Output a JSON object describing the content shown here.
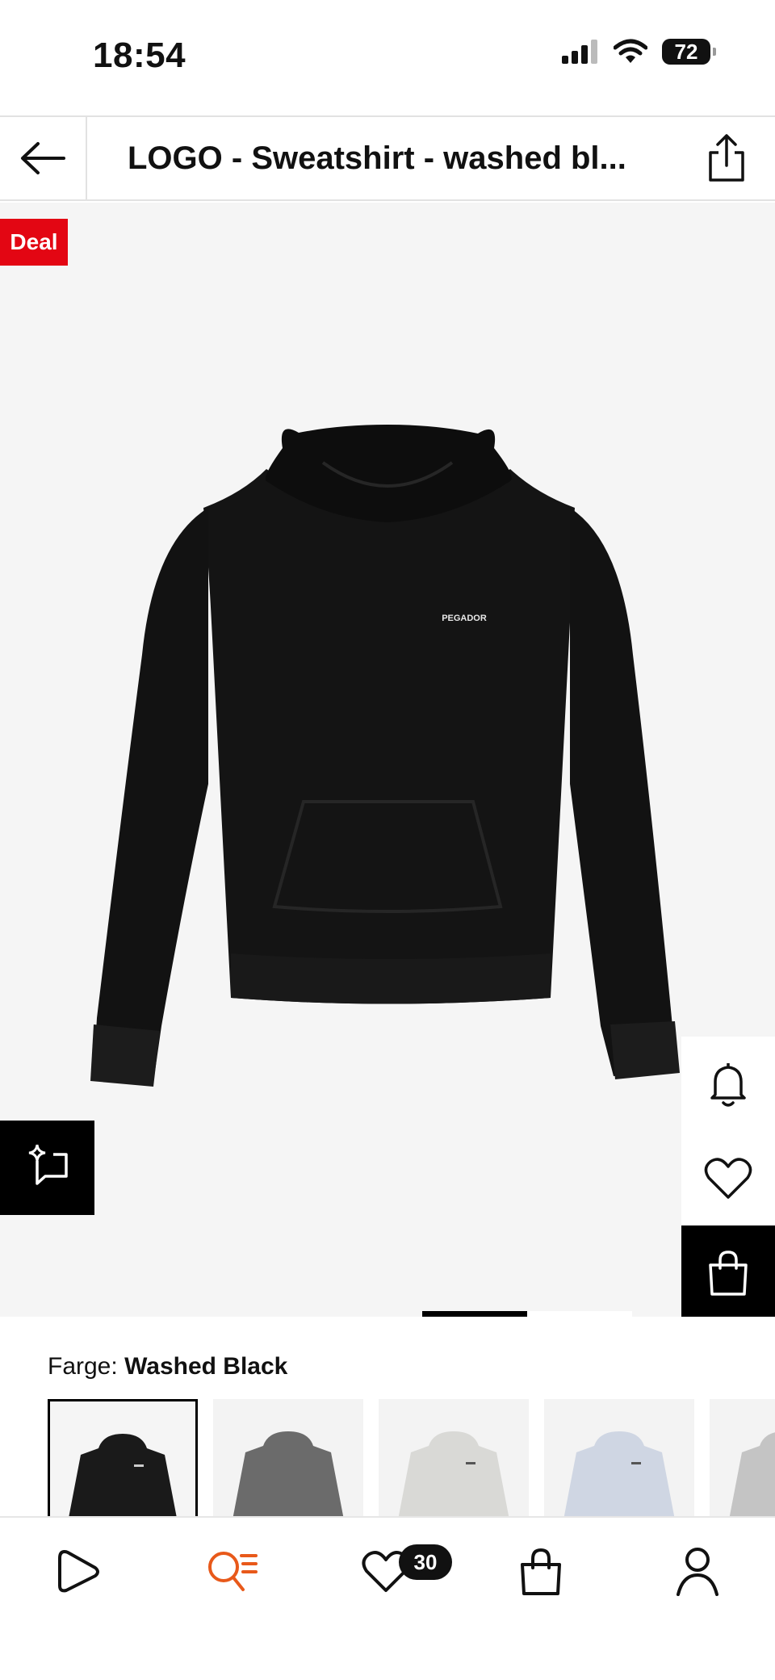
{
  "status_bar": {
    "time": "18:54",
    "battery": "72"
  },
  "nav": {
    "title": "LOGO  - Sweatshirt - washed bl..."
  },
  "gallery": {
    "deal_badge": "Deal",
    "brand_print": "PEGADOR"
  },
  "color": {
    "label": "Farge:",
    "value": "Washed Black",
    "swatch_colors": [
      "#1a1a1a",
      "#6b6b6b",
      "#d9d9d6",
      "#cfd6e3",
      "#c4c4c4"
    ]
  },
  "tabbar": {
    "wishlist_count": "30"
  },
  "colors": {
    "deal": "#e30613",
    "accent_search": "#e8591a"
  }
}
